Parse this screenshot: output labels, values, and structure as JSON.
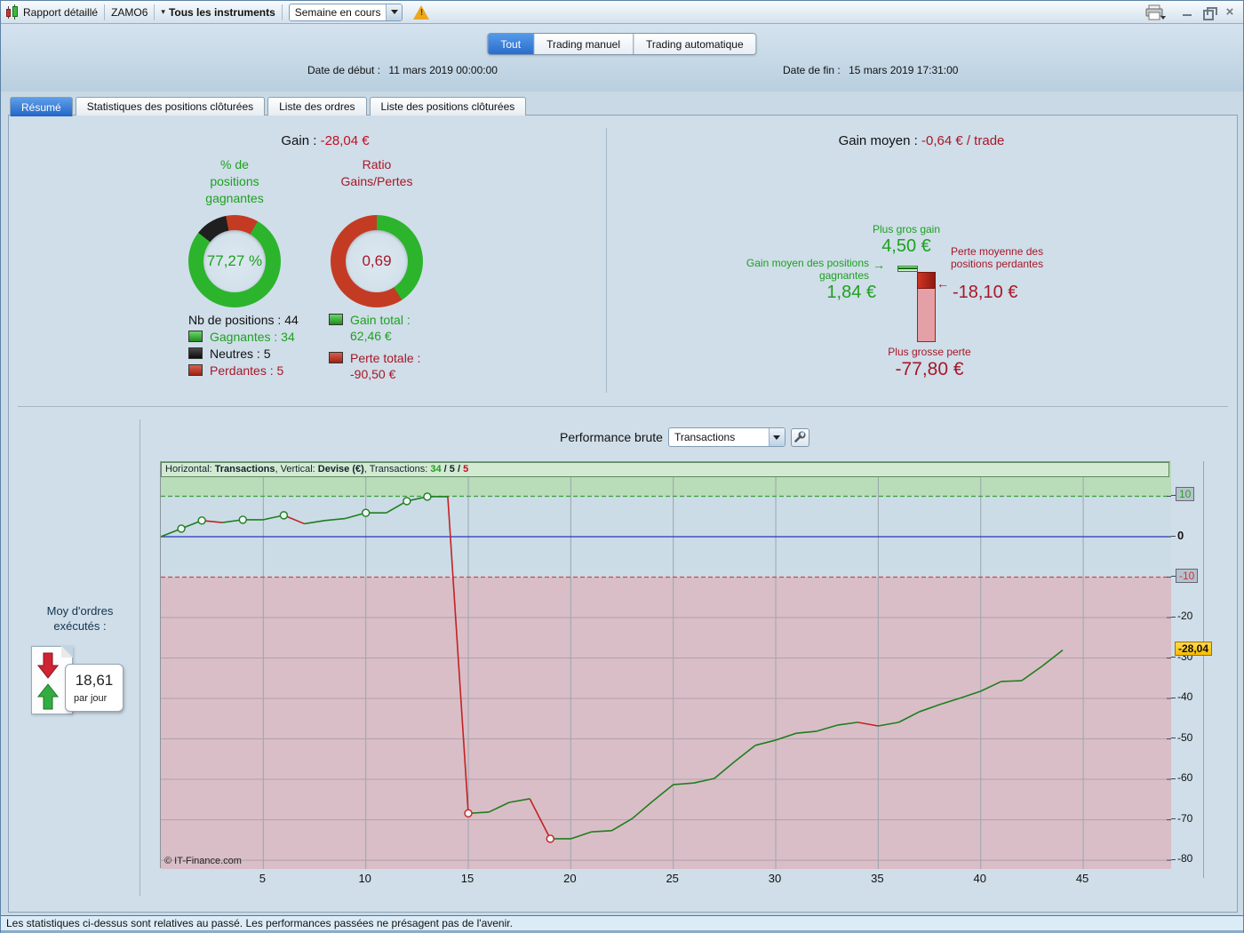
{
  "icons": {
    "arrow_right": "→",
    "arrow_left": "←",
    "close": "×",
    "caret_small": "▾",
    "warning": "!"
  },
  "titlebar": {
    "title": "Rapport détaillé",
    "instrument": "ZAMO6",
    "instruments_filter": "Tous les instruments",
    "period_value": "Semaine en cours"
  },
  "header": {
    "tabs": [
      {
        "label": "Tout",
        "active": true
      },
      {
        "label": "Trading manuel",
        "active": false
      },
      {
        "label": "Trading automatique",
        "active": false
      }
    ],
    "date_start_label": "Date de début :",
    "date_start_value": "11 mars 2019 00:00:00",
    "date_end_label": "Date de fin :",
    "date_end_value": "15 mars 2019 17:31:00"
  },
  "report_tabs": [
    {
      "label": "Résumé",
      "active": true
    },
    {
      "label": "Statistiques des positions clôturées",
      "active": false
    },
    {
      "label": "Liste des ordres",
      "active": false
    },
    {
      "label": "Liste des positions clôturées",
      "active": false
    }
  ],
  "summary_left": {
    "gain_label": "Gain :",
    "gain_value": "-28,04 €",
    "donut1": {
      "title_lines": [
        "% de",
        "positions",
        "gagnantes"
      ],
      "center": "77,27 %",
      "start_deg": 30,
      "segments": [
        {
          "name": "gagnantes",
          "pct": 77.27,
          "color": "#2cb42c"
        },
        {
          "name": "neutres",
          "pct": 11.36,
          "color": "#1f1f1f"
        },
        {
          "name": "perdantes",
          "pct": 11.37,
          "color": "#c43b24"
        }
      ]
    },
    "donut2": {
      "title_lines": [
        "Ratio",
        "Gains/Pertes"
      ],
      "center": "0,69",
      "start_deg": 0,
      "segments": [
        {
          "name": "gains",
          "pct": 40.8,
          "color": "#2cb42c"
        },
        {
          "name": "pertes",
          "pct": 59.2,
          "color": "#c43b24"
        }
      ]
    },
    "nb_positions_label": "Nb de positions :",
    "nb_positions_value": "44",
    "legend": [
      {
        "label": "Gagnantes :",
        "value": "34"
      },
      {
        "label": "Neutres :",
        "value": "5"
      },
      {
        "label": "Perdantes :",
        "value": "5"
      }
    ],
    "gain_total_label": "Gain total :",
    "gain_total_value": "62,46 €",
    "perte_totale_label": "Perte totale :",
    "perte_totale_value": "-90,50 €"
  },
  "summary_right": {
    "title_label": "Gain moyen :",
    "title_value": "-0,64 € / trade",
    "best_gain_label": "Plus gros gain",
    "best_gain_value": "4,50 €",
    "avg_win_label_line1": "Gain moyen des positions",
    "avg_win_label_line2": "gagnantes",
    "avg_win_value": "1,84 €",
    "avg_loss_label_line1": "Perte moyenne des",
    "avg_loss_label_line2": "positions perdantes",
    "avg_loss_value": "-18,10 €",
    "worst_loss_label": "Plus grosse perte",
    "worst_loss_value": "-77,80 €",
    "bars": {
      "max_gain": 4.5,
      "avg_gain": 1.84,
      "max_loss": 77.8,
      "avg_loss": 18.1
    }
  },
  "performance": {
    "label": "Performance brute",
    "select_value": "Transactions"
  },
  "orders_avg": {
    "label_line1": "Moy d'ordres",
    "label_line2": "exécutés :",
    "value": "18,61",
    "unit": "par jour"
  },
  "chart_data": {
    "type": "line",
    "title": "Performance brute",
    "xlabel": "Transactions",
    "ylabel": "Devise (€)",
    "info": {
      "p1": "Horizontal: ",
      "h": "Transactions",
      "p2": ", Vertical: ",
      "v": "Devise (€)",
      "p3": ", Transactions: ",
      "win": "34",
      "sep1": " / ",
      "neu": "5",
      "sep2": " / ",
      "los": "5"
    },
    "x_start": 0,
    "values": [
      0,
      2,
      4,
      3.5,
      4.2,
      4.2,
      5.3,
      3.2,
      4,
      4.5,
      5.9,
      5.9,
      8.8,
      9.9,
      9.9,
      -68.4,
      -68.1,
      -65.7,
      -64.8,
      -74.7,
      -74.7,
      -73,
      -72.7,
      -69.7,
      -65.4,
      -61.3,
      -60.9,
      -59.8,
      -55.6,
      -51.6,
      -50.3,
      -48.6,
      -48.1,
      -46.6,
      -45.9,
      -46.8,
      -45.9,
      -43.3,
      -41.5,
      -39.9,
      -38.2,
      -35.8,
      -35.6,
      -32,
      -28.04
    ],
    "markers": [
      1,
      2,
      4,
      6,
      10,
      12,
      13,
      15,
      19
    ],
    "xticks": [
      5,
      10,
      15,
      20,
      25,
      30,
      35,
      40,
      45
    ],
    "yticks": [
      10,
      0,
      -10,
      -20,
      -30,
      -40,
      -50,
      -60,
      -70,
      -80
    ],
    "ylim": [
      -82,
      18.5
    ],
    "xlim": [
      0,
      49.3
    ],
    "zones": {
      "upper": 10,
      "lower": -10
    },
    "current": {
      "label": "-28,04",
      "value": -28.04
    },
    "copyright": "© IT-Finance.com",
    "legend_position": "none",
    "grid": true,
    "colors": {
      "up": "#1e7e1e",
      "down": "#c32222",
      "band_pos": "#b9dcb9",
      "band_mid": "#cbdce6",
      "band_neg": "#d9bec7",
      "zero": "#2333c4",
      "grid_v": "#9aa6ae",
      "grid_h": "#b1a0aa",
      "dash_pos": "#3aa03a",
      "dash_neg": "#cc4848",
      "highlight": "#ffcc11"
    }
  },
  "status_bar": {
    "text": "Les statistiques ci-dessus sont relatives au passé. Les performances passées ne présagent pas de l'avenir."
  }
}
